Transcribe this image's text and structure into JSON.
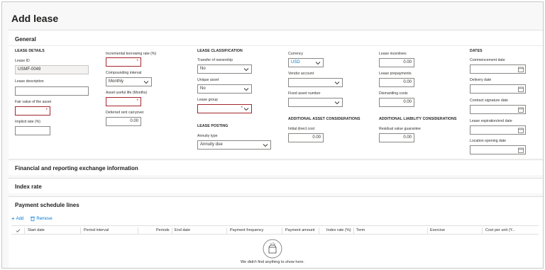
{
  "page": {
    "title": "Add lease"
  },
  "sections": {
    "general": "General",
    "financial": "Financial and reporting exchange information",
    "index_rate": "Index rate",
    "payment_schedule": "Payment schedule lines"
  },
  "lease_details": {
    "heading": "LEASE DETAILS",
    "lease_id_label": "Lease ID",
    "lease_id_value": "USMF-0049",
    "lease_description_label": "Lease description",
    "lease_description_value": "",
    "fair_value_label": "Fair value of the asset",
    "fair_value_value": "",
    "implicit_rate_label": "Implicit rate (%)",
    "implicit_rate_value": ""
  },
  "rates": {
    "incremental_label": "Incremental borrowing rate (%)",
    "incremental_value": "",
    "compounding_label": "Compounding interval",
    "compounding_value": "Monthly",
    "useful_life_label": "Asset useful life (Months)",
    "useful_life_value": "",
    "deferred_rent_label": "Deferred rent carryover",
    "deferred_rent_value": "0.00"
  },
  "classification": {
    "heading": "LEASE CLASSIFICATION",
    "transfer_label": "Transfer of ownership",
    "transfer_value": "No",
    "unique_label": "Unique asset",
    "unique_value": "No",
    "group_label": "Lease group",
    "group_value": "",
    "posting_heading": "LEASE POSTING",
    "annuity_label": "Annuity type",
    "annuity_value": "Annuity due"
  },
  "currency": {
    "currency_label": "Currency",
    "currency_value": "USD",
    "vendor_label": "Vendor account",
    "vendor_value": "",
    "fixed_asset_label": "Fixed asset number",
    "fixed_asset_value": "",
    "asset_heading": "ADDITIONAL ASSET CONSIDERATIONS",
    "initial_cost_label": "Initial direct cost",
    "initial_cost_value": "0.00"
  },
  "incentives": {
    "incentives_label": "Lease incentives",
    "incentives_value": "0.00",
    "prepayments_label": "Lease prepayments",
    "prepayments_value": "0.00",
    "dismantling_label": "Dismantling costs",
    "dismantling_value": "0.00",
    "liability_heading": "ADDITIONAL LIABILITY CONSIDERATIONS",
    "residual_label": "Residual value guarantee",
    "residual_value": "0.00"
  },
  "dates": {
    "heading": "DATES",
    "commencement_label": "Commencement date",
    "delivery_label": "Delivery date",
    "signature_label": "Contract signature date",
    "expiration_label": "Lease expiration/end date",
    "location_label": "Location opening date"
  },
  "toolbar": {
    "add": "Add",
    "remove": "Remove"
  },
  "grid": {
    "columns": [
      "Start date",
      "Period interval",
      "Periods",
      "End date",
      "Payment frequency",
      "Payment amount",
      "Index rate (%)",
      "Term",
      "Exercise",
      "Cost per unit (Y..."
    ],
    "empty_message": "We didn't find anything to show here."
  },
  "colors": {
    "accent": "#0078d4",
    "required": "#a4262c"
  }
}
